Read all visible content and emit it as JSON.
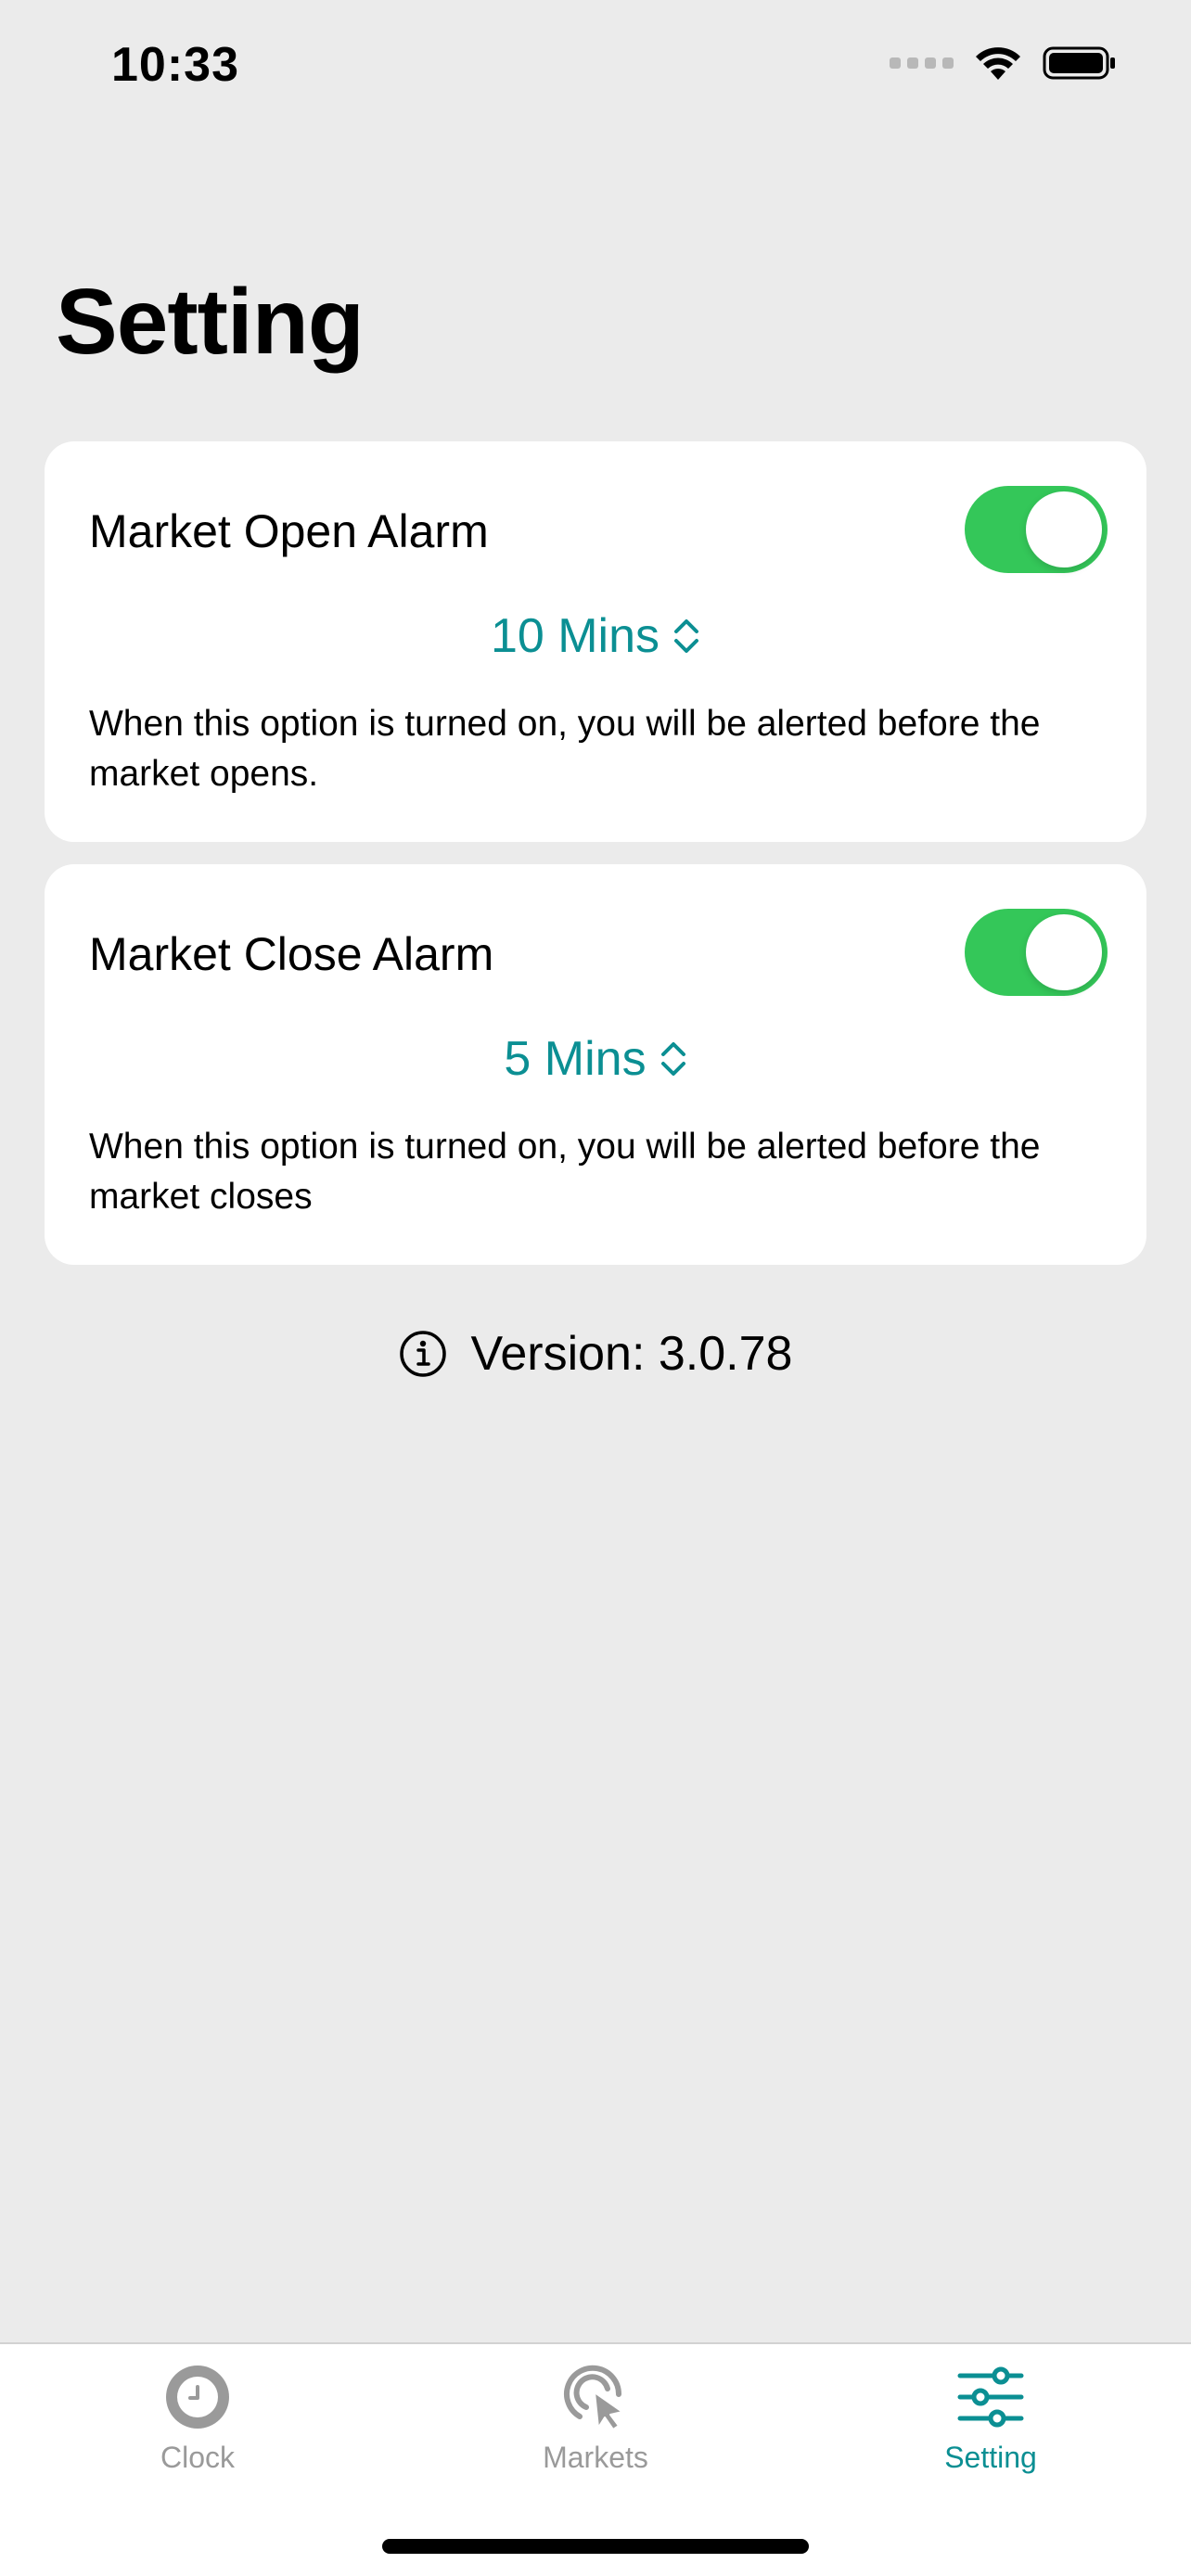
{
  "status_bar": {
    "time": "10:33",
    "icons": [
      "signal-icon",
      "wifi-icon",
      "battery-icon"
    ]
  },
  "page": {
    "title": "Setting"
  },
  "settings": {
    "open_alarm": {
      "label": "Market Open Alarm",
      "enabled": true,
      "value": "10 Mins",
      "description": "When this option is turned on, you will be alerted before the market opens."
    },
    "close_alarm": {
      "label": "Market Close Alarm",
      "enabled": true,
      "value": "5 Mins",
      "description": "When this option is turned on, you will be alerted before the market closes"
    }
  },
  "version": {
    "text": "Version: 3.0.78"
  },
  "tab_bar": {
    "tabs": [
      {
        "label": "Clock",
        "icon": "clock-icon",
        "active": false
      },
      {
        "label": "Markets",
        "icon": "cursor-click-icon",
        "active": false
      },
      {
        "label": "Setting",
        "icon": "sliders-icon",
        "active": true
      }
    ]
  },
  "colors": {
    "accent": "#0b8f93",
    "toggle_on": "#34c759",
    "background": "#ebebeb",
    "inactive_tab": "#9a9a9a"
  }
}
